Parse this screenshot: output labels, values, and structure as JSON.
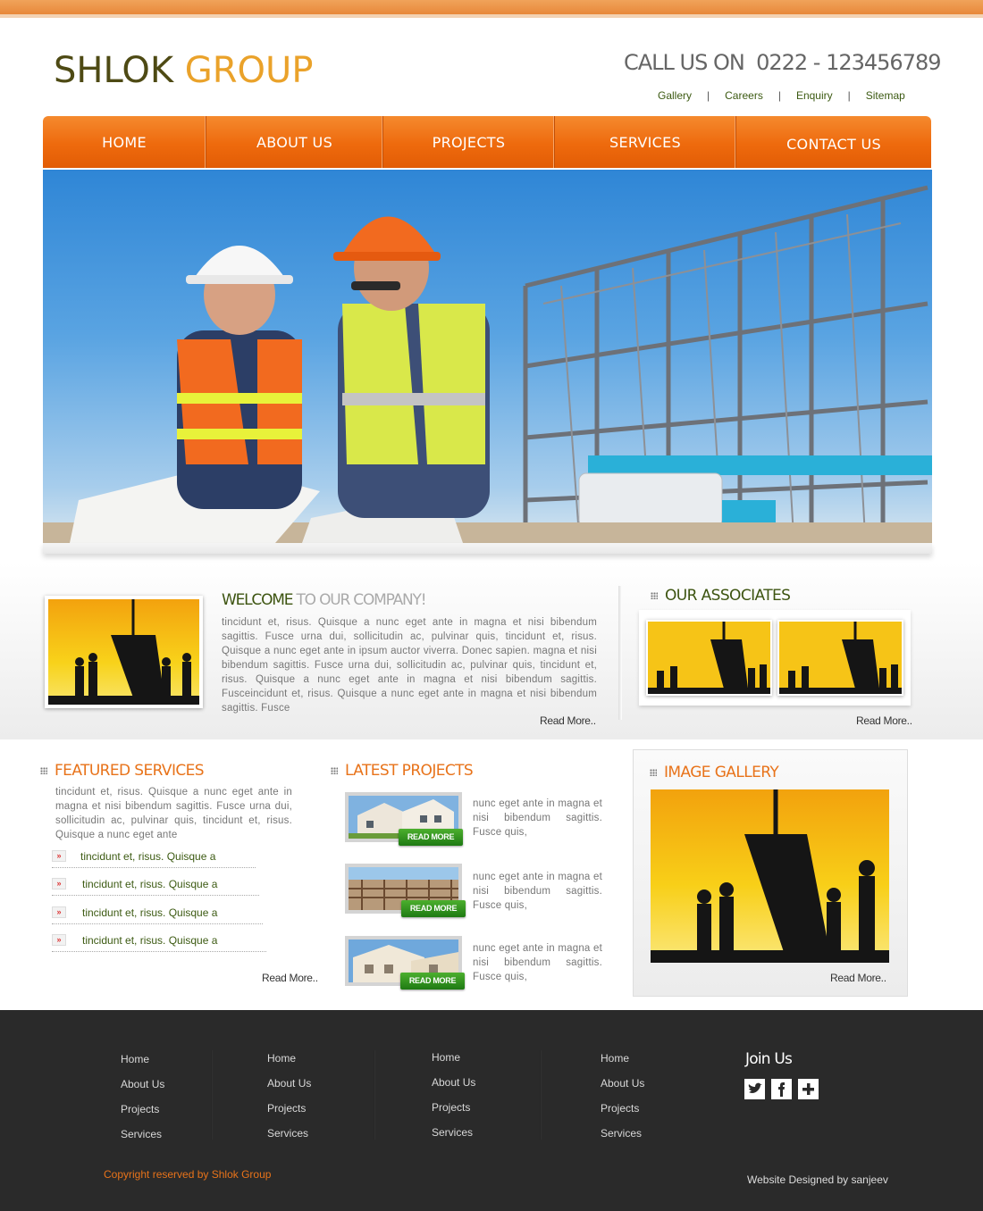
{
  "header": {
    "logo_part1": "SHLOK",
    "logo_part2": "GROUP",
    "phone": "CALL US ON  0222 - 123456789",
    "top_links": [
      "Gallery",
      "Careers",
      "Enquiry",
      "Sitemap"
    ],
    "top_links_separator": "|"
  },
  "nav": {
    "items": [
      "HOME",
      "ABOUT US",
      "PROJECTS",
      "SERVICES",
      "CONTACT US"
    ]
  },
  "welcome": {
    "title_part1": "WELCOME",
    "title_part2": "TO OUR COMPANY!",
    "text": "tincidunt et, risus. Quisque a nunc eget ante in magna et nisi bibendum sagittis. Fusce urna dui, sollicitudin ac, pulvinar quis, tincidunt et, risus. Quisque a nunc eget ante in ipsum auctor viverra. Donec sapien. magna et nisi bibendum sagittis. Fusce urna dui, sollicitudin ac, pulvinar quis, tincidunt et, risus. Quisque a nunc eget ante in magna et nisi bibendum sagittis. Fusceincidunt et, risus. Quisque a nunc eget ante in magna et nisi bibendum sagittis. Fusce",
    "read_more": "Read More.."
  },
  "associates": {
    "title": "OUR ASSOCIATES",
    "read_more": "Read More.."
  },
  "featured": {
    "title": "FEATURED SERVICES",
    "text": "tincidunt et, risus. Quisque a nunc eget ante in magna et nisi bibendum sagittis. Fusce urna dui, sollicitudin ac, pulvinar quis, tincidunt et, risus. Quisque a nunc eget ante",
    "items": [
      "tincidunt et, risus. Quisque a",
      "tincidunt et, risus. Quisque a",
      "tincidunt et, risus. Quisque a",
      "tincidunt et, risus. Quisque a"
    ],
    "read_more": "Read More.."
  },
  "projects": {
    "title": "LATEST PROJECTS",
    "button_label": "READ MORE",
    "items": [
      {
        "text": "nunc eget ante in magna et nisi bibendum sagittis. Fusce quis,"
      },
      {
        "text": "nunc eget ante in magna et nisi bibendum sagittis. Fusce quis,"
      },
      {
        "text": "nunc eget ante in magna et nisi bibendum sagittis. Fusce quis,"
      }
    ]
  },
  "gallery": {
    "title": "IMAGE GALLERY",
    "read_more": "Read More.."
  },
  "footer": {
    "columns": [
      [
        "Home",
        "About Us",
        "Projects",
        "Services"
      ],
      [
        "Home",
        "About Us",
        "Projects",
        "Services"
      ],
      [
        "Home",
        "About Us",
        "Projects",
        "Services"
      ],
      [
        "Home",
        "About Us",
        "Projects",
        "Services"
      ]
    ],
    "join_title": "Join Us",
    "social_icons": [
      "twitter-icon",
      "facebook-icon",
      "plus-icon"
    ],
    "copyright": "Copyright reserved by Shlok Group",
    "designed_by": "Website Designed by sanjeev"
  },
  "colors": {
    "brand_orange": "#ee6a0d",
    "brand_green": "#3d5410",
    "logo_gold": "#eaa22a",
    "footer_bg": "#2a2a2a"
  }
}
